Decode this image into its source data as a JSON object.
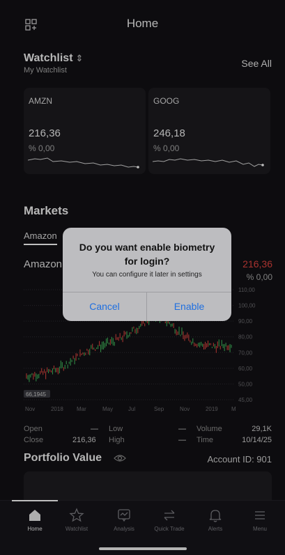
{
  "header": {
    "title": "Home",
    "left_icon": "grid-plus-icon"
  },
  "watchlist": {
    "title": "Watchlist",
    "sort_icon": "sort-arrows-icon",
    "subtitle": "My Watchlist",
    "see_all": "See All",
    "cards": [
      {
        "symbol": "AMZN",
        "price": "216,36",
        "change": "% 0,00"
      },
      {
        "symbol": "GOOG",
        "price": "246,18",
        "change": "% 0,00"
      }
    ]
  },
  "markets": {
    "title": "Markets",
    "tab": "Amazon",
    "stock_name": "Amazon",
    "price": "216,36",
    "change": "% 0,00",
    "price_color": "#e0433f",
    "chart_data": {
      "type": "line",
      "x_ticks": [
        "Nov",
        "2018",
        "Mar",
        "May",
        "Jul",
        "Sep",
        "Nov",
        "2019",
        "M"
      ],
      "y_ticks": [
        "110,00",
        "100,00",
        "90,00",
        "80,00",
        "70,00",
        "60,00",
        "50,00",
        "45,00"
      ],
      "last_marker": "66,1945"
    }
  },
  "stats": {
    "open_label": "Open",
    "open_value": "—",
    "low_label": "Low",
    "low_value": "—",
    "volume_label": "Volume",
    "volume_value": "29,1K",
    "close_label": "Close",
    "close_value": "216,36",
    "high_label": "High",
    "high_value": "—",
    "time_label": "Time",
    "time_value": "10/14/25"
  },
  "portfolio": {
    "title": "Portfolio Value",
    "account": "Account ID: 901",
    "eye_icon": "eye-icon"
  },
  "tabbar": {
    "items": [
      {
        "label": "Home",
        "icon": "home-icon"
      },
      {
        "label": "Watchlist",
        "icon": "star-icon"
      },
      {
        "label": "Analysis",
        "icon": "chat-chart-icon"
      },
      {
        "label": "Quick Trade",
        "icon": "swap-arrows-icon"
      },
      {
        "label": "Alerts",
        "icon": "bell-icon"
      },
      {
        "label": "Menu",
        "icon": "menu-icon"
      }
    ]
  },
  "dialog": {
    "title_line1": "Do you want enable biometry",
    "title_line2": "for login?",
    "message": "You can configure it later in settings",
    "cancel": "Cancel",
    "enable": "Enable"
  }
}
